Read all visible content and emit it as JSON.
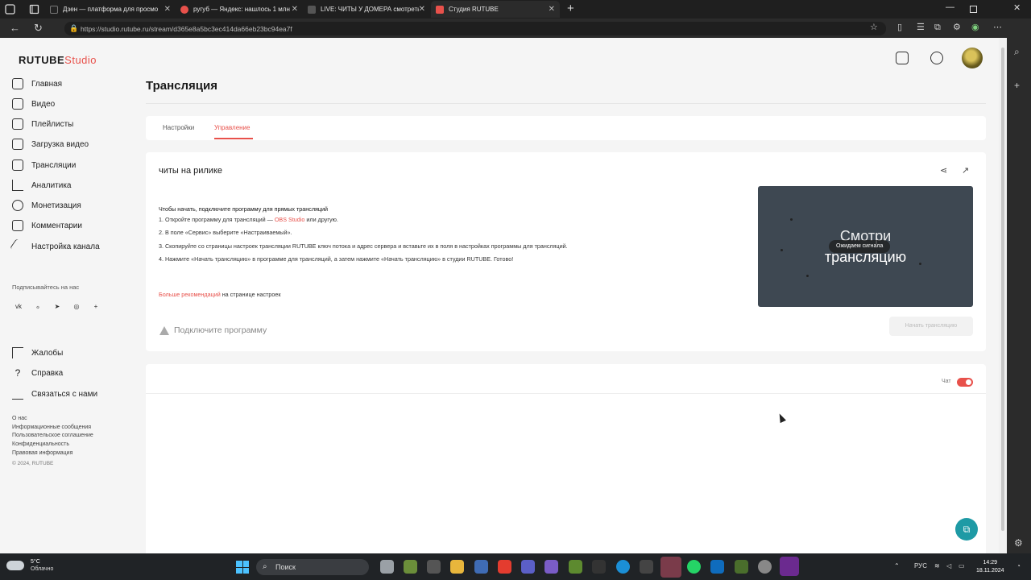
{
  "browser": {
    "tabs": [
      {
        "title": "Дзен — платформа для просмо",
        "color": "#222222"
      },
      {
        "title": "ругуб — Яндекс: нашлось 1 млн",
        "color": "#e8514b"
      },
      {
        "title": "LIVE: ЧИТЫ У ДОМЕРА смотреть",
        "color": "#555555"
      },
      {
        "title": "Студия RUTUBE",
        "color": "#e8514b"
      }
    ],
    "url": "https://studio.rutube.ru/stream/d365e8a5bc3ec414da66eb23bc94ea7f"
  },
  "sidebar": {
    "logo_main": "RUTUBE",
    "logo_accent": "Studio",
    "items": [
      {
        "label": "Главная"
      },
      {
        "label": "Видео"
      },
      {
        "label": "Плейлисты"
      },
      {
        "label": "Загрузка видео"
      },
      {
        "label": "Трансляции"
      },
      {
        "label": "Аналитика"
      },
      {
        "label": "Монетизация"
      },
      {
        "label": "Комментарии"
      },
      {
        "label": "Настройка канала"
      }
    ],
    "subscribe_title": "Подписывайтесь на нас",
    "socials": [
      "vk",
      "ok",
      "tg",
      "viber",
      "+"
    ],
    "social_glyphs": [
      "vk",
      "ℴ",
      "➤",
      "◎",
      "+"
    ],
    "support_items": [
      {
        "label": "Жалобы"
      },
      {
        "label": "Справка"
      },
      {
        "label": "Связаться с нами"
      }
    ],
    "footer_links": [
      "О нас",
      "Информационные сообщения",
      "Пользовательское соглашение",
      "Конфиденциальность",
      "Правовая информация"
    ],
    "copyright": "© 2024, RUTUBE"
  },
  "main": {
    "title": "Трансляция",
    "tabs": [
      {
        "label": "Настройки"
      },
      {
        "label": "Управление"
      }
    ],
    "stream": {
      "name": "читы на рилике",
      "instructions_lead": "Чтобы начать, подключите программу для прямых трансляций",
      "step1_pre": "1. Откройте программу для трансляций — ",
      "step1_link": "OBS Studio",
      "step1_post": " или другую.",
      "step2": "2. В поле «Сервис» выберите «Настраиваемый».",
      "step3": "3. Скопируйте со страницы настроек трансляции RUTUBE ключ потока и адрес сервера и вставьте их в поля в настройках программы для трансляций.",
      "step4": "4. Нажмите «Начать трансляцию» в программе для трансляций, а затем нажмите «Начать трансляцию» в студии RUTUBE. Готово!",
      "more_link": "Больше рекомендаций",
      "more_text": " на странице настроек",
      "connect_status": "Подключите программу",
      "preview_line1": "Смотри",
      "preview_line2": "трансляцию",
      "preview_badge": "Ожидаем сигнала",
      "start_button": "Начать трансляцию"
    },
    "chat": {
      "label": "Чат",
      "enabled": true
    }
  },
  "taskbar": {
    "temperature": "5°C",
    "weather": "Облачно",
    "search": "Поиск",
    "lang": "РУС",
    "time": "14:29",
    "date": "18.11.2024"
  },
  "colors": {
    "accent": "#e8514b",
    "help": "#1e9aa5"
  }
}
